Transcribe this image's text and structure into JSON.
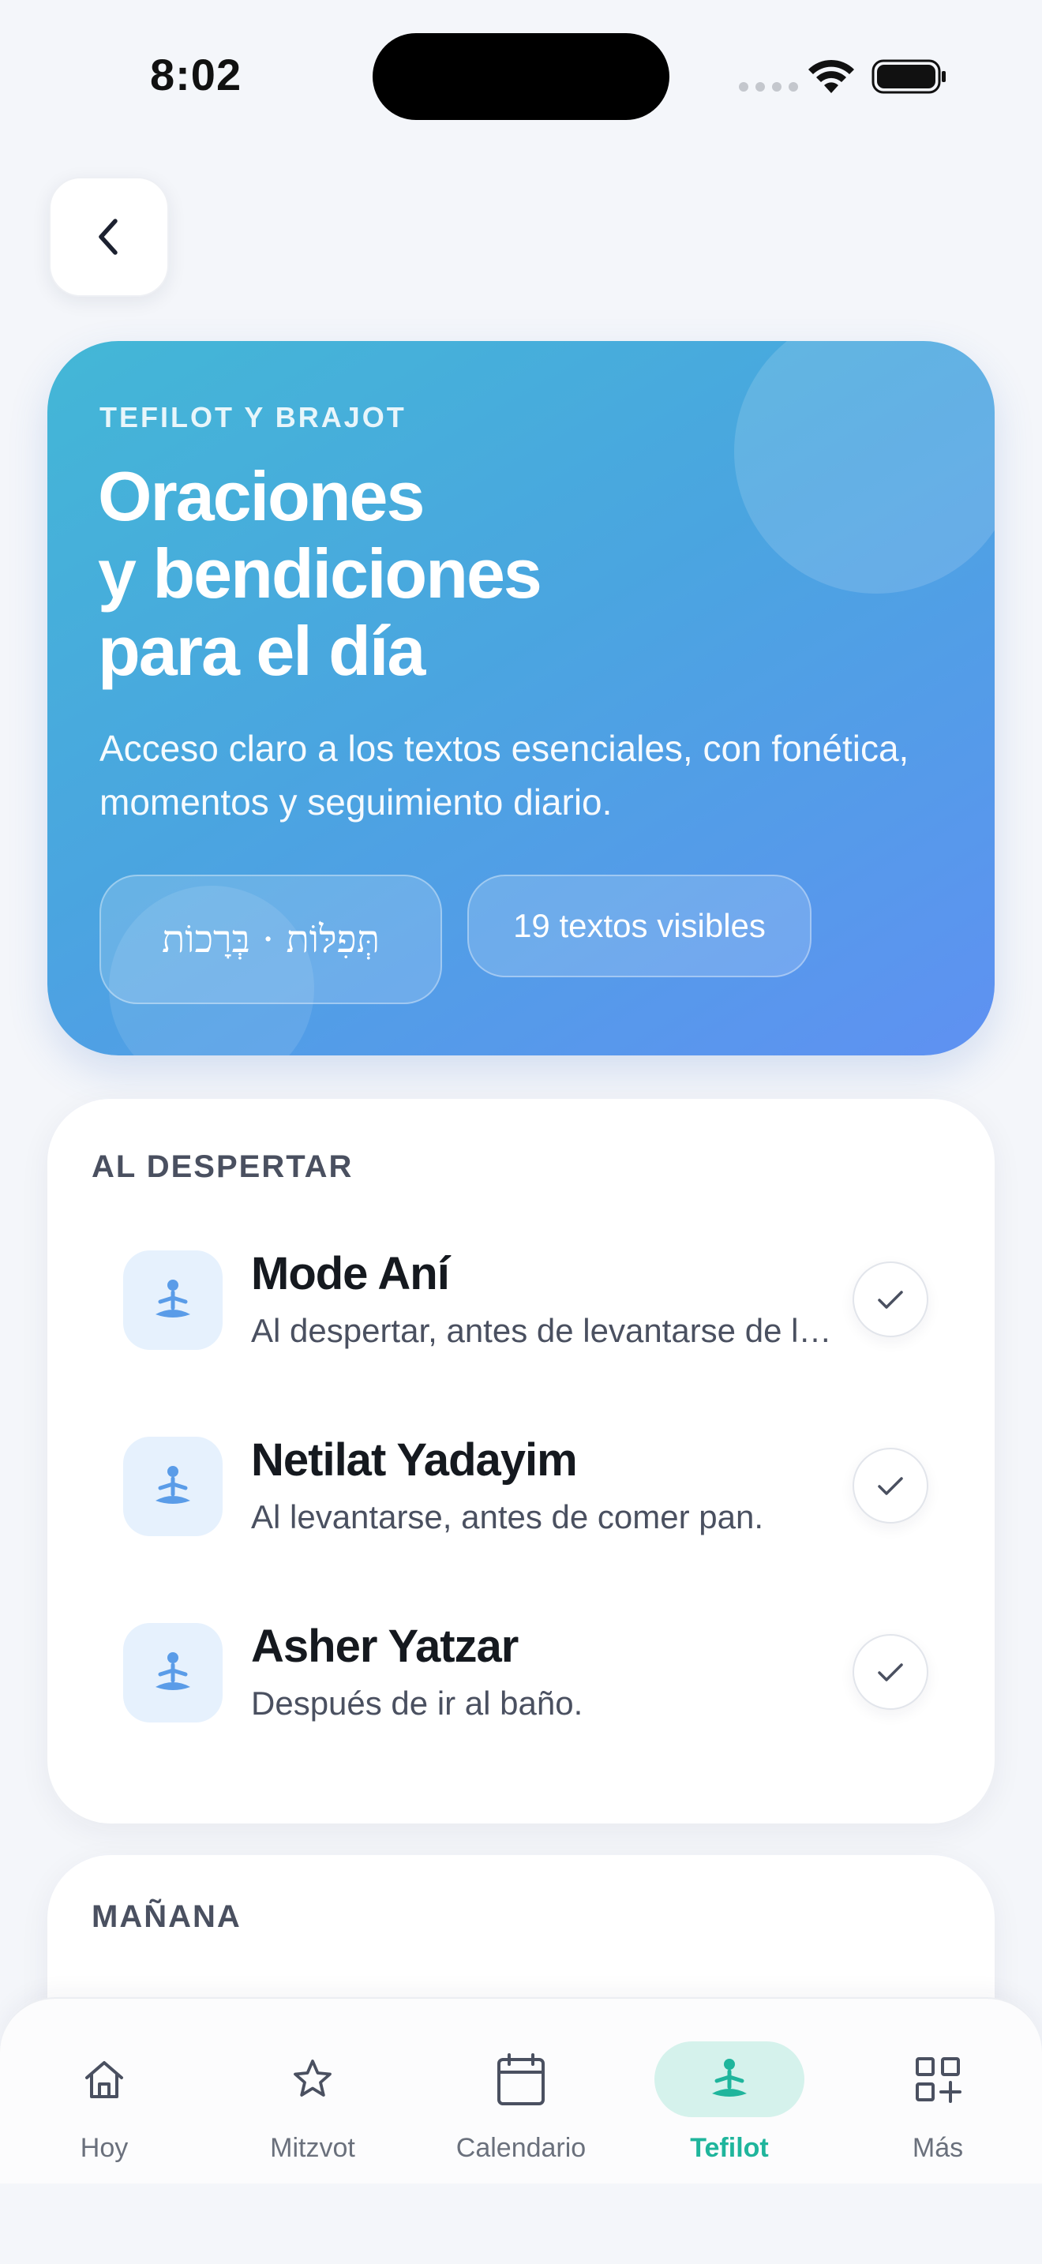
{
  "status_bar": {
    "time": "8:02"
  },
  "hero": {
    "eyebrow": "TEFILOT Y BRAJOT",
    "title_lines": [
      "Oraciones",
      "y bendiciones",
      "para el día"
    ],
    "subtitle": "Acceso claro a los textos esenciales, con fonética, momentos y seguimiento diario.",
    "hebrew_chip": "תְּפִלּוֹת · בְּרָכוֹת",
    "count_chip": "19 textos visibles"
  },
  "sections": [
    {
      "title": "AL DESPERTAR",
      "items": [
        {
          "title": "Mode Aní",
          "desc": "Al despertar, antes de levantarse de la cama.",
          "icon": "prayer-icon"
        },
        {
          "title": "Netilat Yadayim",
          "desc": "Al levantarse, antes de comer pan.",
          "icon": "prayer-icon"
        },
        {
          "title": "Asher Yatzar",
          "desc": "Después de ir al baño.",
          "icon": "prayer-icon"
        }
      ]
    },
    {
      "title": "MAÑANA"
    }
  ],
  "tabbar": {
    "tabs": [
      {
        "label": "Hoy",
        "icon": "home-icon"
      },
      {
        "label": "Mitzvot",
        "icon": "star-icon"
      },
      {
        "label": "Calendario",
        "icon": "calendar-icon"
      },
      {
        "label": "Tefilot",
        "icon": "prayer-icon",
        "active": true
      },
      {
        "label": "Más",
        "icon": "grid-plus-icon"
      }
    ]
  },
  "colors": {
    "accent": "#1fb59c",
    "hero_start": "#43b7d6",
    "hero_end": "#5f91f2",
    "icon_blue": "#5a9ce8"
  }
}
